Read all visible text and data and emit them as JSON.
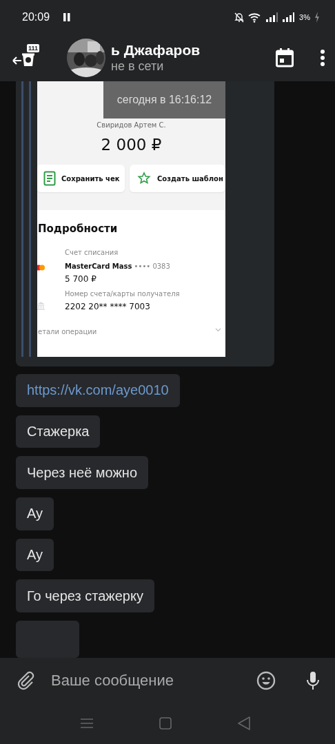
{
  "status_bar": {
    "time": "20:09",
    "battery": "3%"
  },
  "header": {
    "badge": "111",
    "name": "ь Джафаров",
    "status": "не в сети"
  },
  "forwarded_image": {
    "timestamp": "сегодня в 16:16:12",
    "payer": "Свиридов Артем С.",
    "amount": "2 000 ₽",
    "actions": [
      "Сохранить чек",
      "Создать шаблон"
    ],
    "section_title": "Подробности",
    "source_label": "Счет списания",
    "card_name": "MasterCard Mass",
    "card_mask": "•••• 0383",
    "card_balance": "5 700 ₽",
    "recipient_label": "Номер счета/карты получателя",
    "recipient_number": "2202 20** **** 7003",
    "details": "етали операции"
  },
  "messages": [
    {
      "kind": "link",
      "text": "https://vk.com/aye0010"
    },
    {
      "kind": "text",
      "text": "Стажерка"
    },
    {
      "kind": "text",
      "text": "Через неё можно"
    },
    {
      "kind": "text",
      "text": "Ау"
    },
    {
      "kind": "text",
      "text": "Ау"
    },
    {
      "kind": "text",
      "text": "Го через стажерку"
    }
  ],
  "composer": {
    "placeholder": "Ваше сообщение"
  }
}
